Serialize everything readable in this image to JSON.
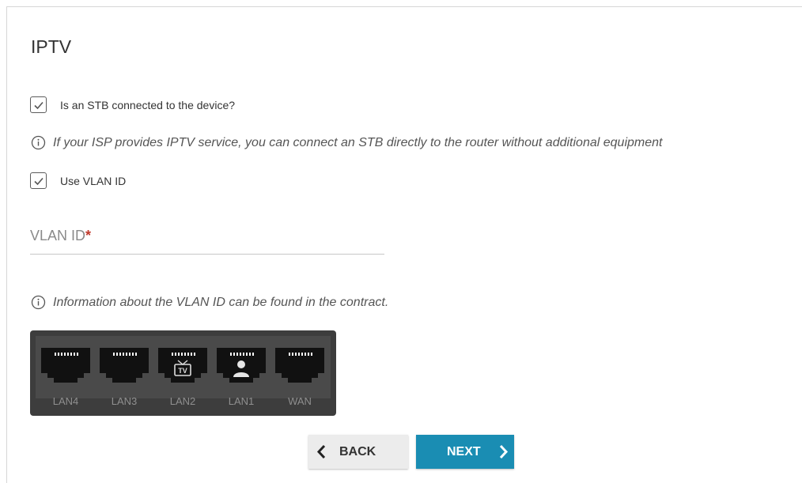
{
  "page": {
    "title": "IPTV"
  },
  "stb_checkbox": {
    "checked": true,
    "label": "Is an STB connected to the device?"
  },
  "stb_info": {
    "text": "If your ISP provides IPTV service, you can connect an STB directly to the router without additional equipment"
  },
  "vlan_checkbox": {
    "checked": true,
    "label": "Use VLAN ID"
  },
  "vlan_field": {
    "label": "VLAN ID",
    "required_mark": "*",
    "value": ""
  },
  "vlan_info": {
    "text": "Information about the VLAN ID can be found in the contract."
  },
  "ports": [
    {
      "label": "LAN4",
      "icon": "none"
    },
    {
      "label": "LAN3",
      "icon": "none"
    },
    {
      "label": "LAN2",
      "icon": "tv-icon",
      "icon_text": "TV"
    },
    {
      "label": "LAN1",
      "icon": "user-icon"
    },
    {
      "label": "WAN",
      "icon": "none"
    }
  ],
  "buttons": {
    "back": "BACK",
    "next": "NEXT"
  },
  "colors": {
    "accent": "#1a8db3",
    "required": "#c0392b",
    "port_panel": "#3d3d3d"
  }
}
